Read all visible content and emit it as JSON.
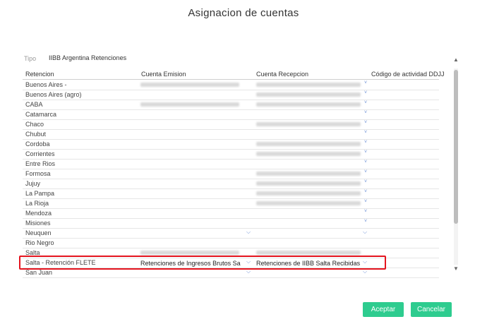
{
  "dialog": {
    "title": "Asignacion de cuentas"
  },
  "tipo": {
    "label": "Tipo",
    "value": "IIBB Argentina Retenciones"
  },
  "columns": {
    "retencion": "Retencion",
    "cuenta_emision": "Cuenta Emision",
    "cuenta_recepcion": "Cuenta Recepcion",
    "codigo": "Código de actividad DDJJ"
  },
  "rows": [
    {
      "retencion": "Buenos Aires -"
    },
    {
      "retencion": "Buenos Aires (agro)"
    },
    {
      "retencion": "CABA"
    },
    {
      "retencion": "Catamarca"
    },
    {
      "retencion": "Chaco"
    },
    {
      "retencion": "Chubut"
    },
    {
      "retencion": "Cordoba"
    },
    {
      "retencion": "Corrientes"
    },
    {
      "retencion": "Entre Rios"
    },
    {
      "retencion": "Formosa"
    },
    {
      "retencion": "Jujuy"
    },
    {
      "retencion": "La Pampa"
    },
    {
      "retencion": "La Rioja"
    },
    {
      "retencion": "Mendoza"
    },
    {
      "retencion": "Misiones"
    },
    {
      "retencion": "Neuquen"
    },
    {
      "retencion": "Rio Negro"
    },
    {
      "retencion": "Salta"
    },
    {
      "retencion": "Salta - Retención FLETE",
      "cuenta_emision": "Retenciones de Ingresos Brutos Salta",
      "cuenta_recepcion": "Retenciones de IIBB Salta Recibidas"
    },
    {
      "retencion": "San Juan"
    }
  ],
  "buttons": {
    "accept": "Aceptar",
    "cancel": "Cancelar"
  },
  "colors": {
    "accent": "#2ecc8f",
    "highlight": "#e4141e",
    "chevron": "#6a8ed4"
  },
  "icons": {
    "dropdown": "chevron-down-icon",
    "scroll_up": "scroll-up-icon",
    "scroll_down": "scroll-down-icon"
  }
}
